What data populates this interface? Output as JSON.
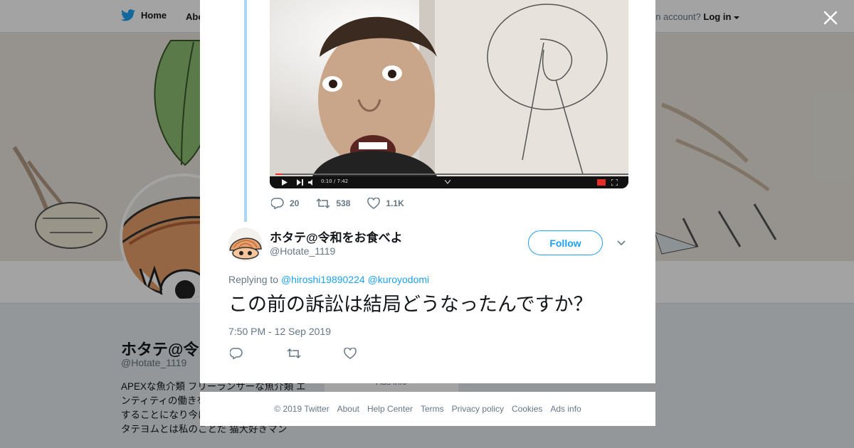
{
  "header": {
    "home_label": "Home",
    "about_label": "About",
    "login_prefix": "Have an account?",
    "login_label": "Log in"
  },
  "profile": {
    "name": "ホタテ@令和をお食べよ",
    "handle": "@Hotate_1119",
    "bio": "APEXな魚介類 フリーランサーな魚介類 エンティティの働きを見ていたらそれを支配することになり今に至る ｱｲﾐｯﾒﾄﾛを歩くホタテヨムとは私のことだ 猫大好きマン",
    "ads_info": "Ads info"
  },
  "previous_tweet": {
    "video_time": "0:10 / 7:42",
    "replies": "20",
    "retweets": "538",
    "likes": "1.1K"
  },
  "tweet": {
    "author_name": "ホタテ@令和をお食べよ",
    "author_handle": "@Hotate_1119",
    "follow_label": "Follow",
    "replying_prefix": "Replying to",
    "reply_to_1": "@hiroshi19890224",
    "reply_to_2": "@kuroyodomi",
    "text": "この前の訴訟は結局どうなったんですか？",
    "timestamp": "7:50 PM - 12 Sep 2019"
  },
  "footer": {
    "copyright": "© 2019 Twitter",
    "links": [
      "About",
      "Help Center",
      "Terms",
      "Privacy policy",
      "Cookies",
      "Ads info"
    ]
  },
  "colors": {
    "brand": "#1da1f2",
    "thread_line": "#a9d7f5",
    "muted_text": "#657786",
    "overlay": "rgba(0,0,0,0.36)"
  },
  "icons": [
    "twitter-bird-icon",
    "close-icon",
    "reply-icon",
    "retweet-icon",
    "like-icon",
    "chevron-down-icon",
    "play-icon",
    "next-icon",
    "volume-icon"
  ]
}
